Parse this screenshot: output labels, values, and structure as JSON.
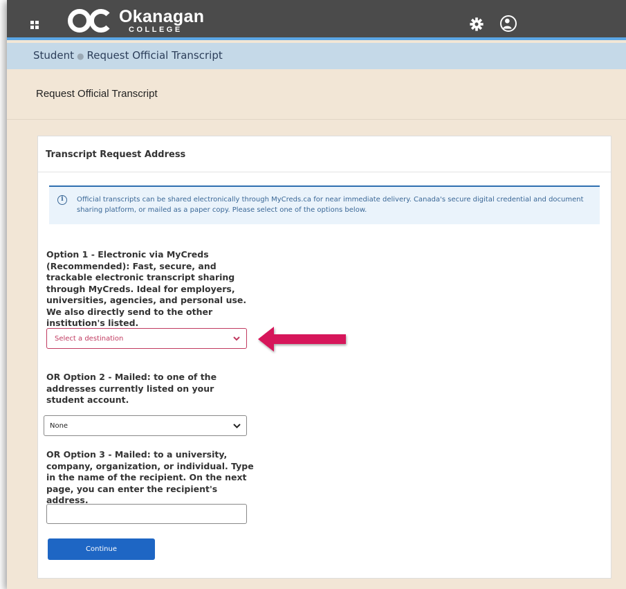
{
  "app": {
    "logo_name": "Okanagan",
    "logo_sub": "COLLEGE",
    "logo_mark": "OC",
    "icons": {
      "apps": "apps-grid-icon",
      "settings": "gear-icon",
      "user": "user-icon"
    },
    "colors": {
      "topbar": "#4b4b4b",
      "accent_line": "#5aa6e6",
      "button": "#1e66c4",
      "error": "#c0395f",
      "arrow": "#d6175a"
    }
  },
  "breadcrumb": {
    "root": "Student",
    "current": "Request Official Transcript"
  },
  "page": {
    "title": "Request Official Transcript"
  },
  "card": {
    "header": "Transcript Request Address",
    "info": "Official transcripts can be shared electronically through MyCreds.ca for near immediate delivery. Canada's secure digital credential and document sharing platform, or mailed as a paper copy. Please select one of the options below.",
    "option1_label": "Option 1 - Electronic via MyCreds (Recommended): Fast, secure, and trackable electronic transcript sharing through MyCreds. Ideal for employers, universities, agencies, and personal use. We also directly send to the other institution's listed.",
    "option1_select": "Select a destination",
    "option2_label": "OR Option 2 - Mailed: to one of the addresses currently listed on your student account.",
    "option2_select": "None",
    "option3_label": "OR Option 3 - Mailed: to a university, company, organization, or individual. Type in the name of the recipient. On the next page, you can enter the recipient's address.",
    "recipient_value": "",
    "continue_label": "Continue"
  }
}
